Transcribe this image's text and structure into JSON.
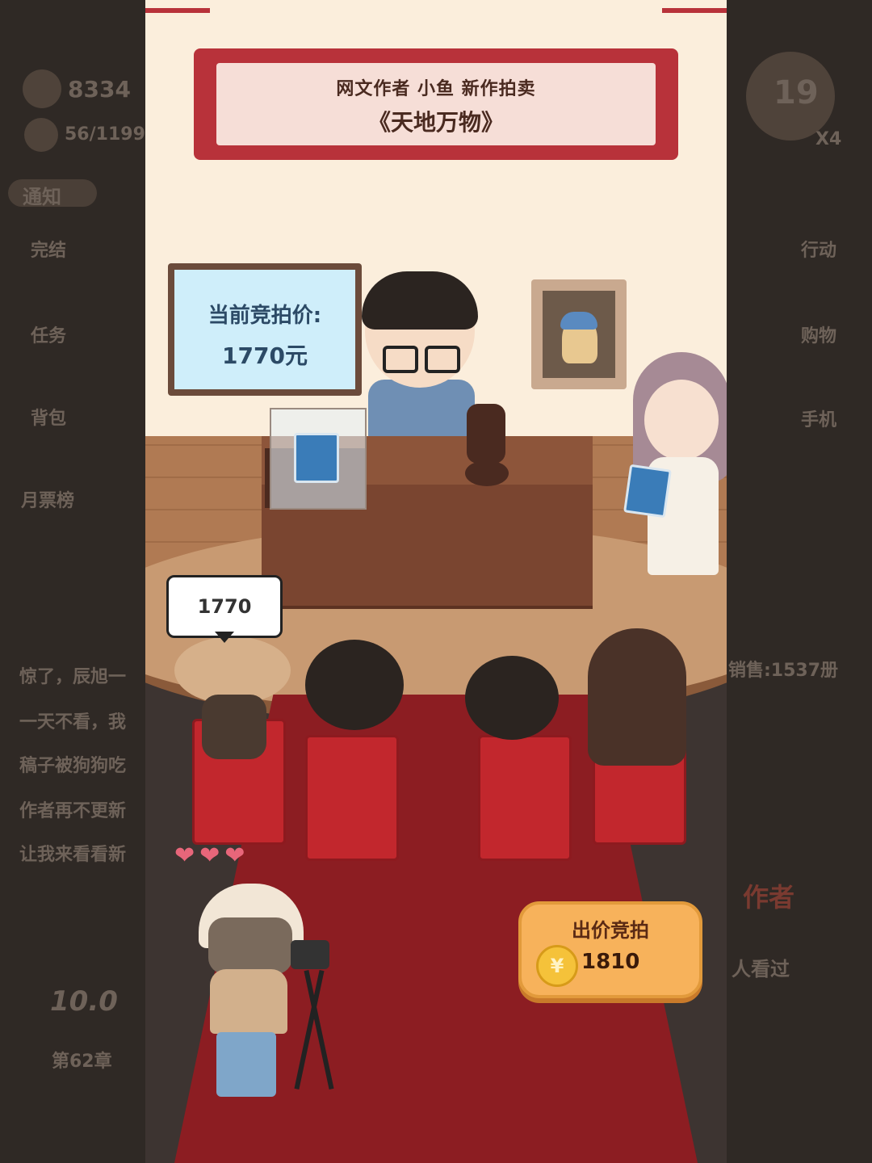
{
  "background": {
    "coins": "8334",
    "tickets": "56/1199",
    "notice_tab": "通知",
    "left_menu": [
      "完结",
      "任务",
      "背包",
      "月票榜"
    ],
    "right_menu": [
      "行动",
      "购物",
      "手机"
    ],
    "timer": "19",
    "multiplier": "X4",
    "sales": "销售:1537册",
    "feed": [
      "惊了，辰旭一",
      "一天不看，我",
      "稿子被狗狗吃",
      "作者再不更新",
      "让我来看看新"
    ],
    "rating": "10.0",
    "chapter": "第62章",
    "author_tab": "作者",
    "watched": "人看过"
  },
  "auction": {
    "banner_line1": "网文作者  小鱼  新作拍卖",
    "banner_line2": "《天地万物》",
    "board_line1": "当前竞拍价:",
    "board_line2": "1770元",
    "bubble_bid": "1770",
    "bid_button_label": "出价竞拍",
    "bid_button_amount": "1810",
    "hearts": "❤❤❤"
  }
}
